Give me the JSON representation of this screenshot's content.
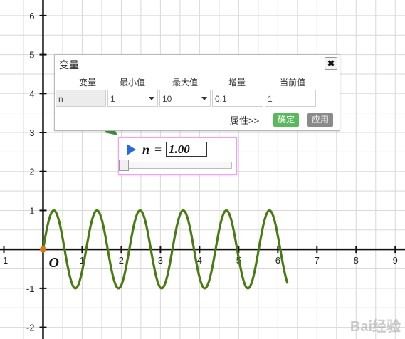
{
  "graph": {
    "x_ticks": [
      "-1",
      "1",
      "2",
      "3",
      "4",
      "5",
      "6",
      "7",
      "8",
      "9"
    ],
    "y_ticks": [
      "6",
      "5",
      "4",
      "3",
      "2",
      "1",
      "-1",
      "-2"
    ],
    "x_range": [
      -1.1,
      9.25
    ],
    "y_range": [
      -2.3,
      6.4
    ],
    "origin_label": "O",
    "curve": {
      "function": "sin(n*x)",
      "n": 5.7,
      "domain": [
        0,
        6.25
      ],
      "color": "#4a7a12"
    },
    "arrow_color": "#3f8f3a",
    "origin_point_color": "#d77a1e",
    "grid_color": "#d8d8d8"
  },
  "variable_dialog": {
    "title": "变量",
    "close_symbol": "✖",
    "headers": [
      "变量",
      "最小值",
      "最大值",
      "增量",
      "当前值"
    ],
    "row": {
      "name": "n",
      "min": "1",
      "max": "10",
      "step": "0.1",
      "current": "1"
    },
    "properties_link": "属性>>",
    "ok_label": "确定",
    "apply_label": "应用"
  },
  "slider": {
    "variable": "n",
    "equals": "=",
    "value_text": "1.00",
    "min": 1,
    "max": 10,
    "value": 1
  },
  "watermark": "Bai经验"
}
